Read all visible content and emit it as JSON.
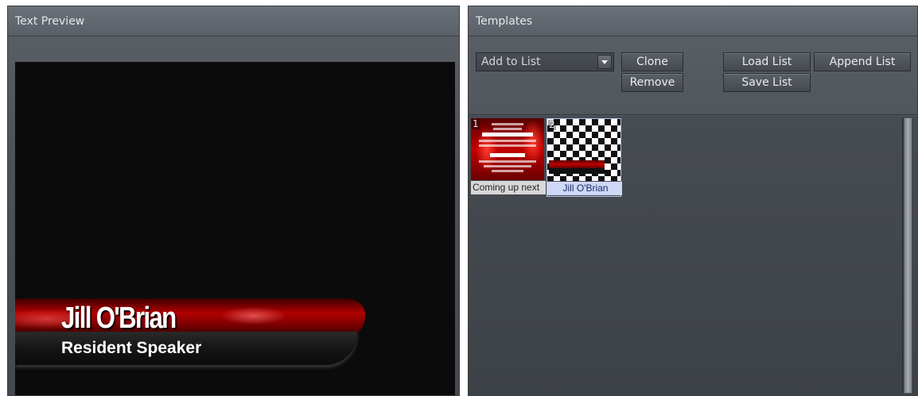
{
  "preview_panel": {
    "title": "Text Preview",
    "lower_third": {
      "name": "Jill O'Brian",
      "title": "Resident Speaker"
    }
  },
  "templates_panel": {
    "title": "Templates",
    "list_select": {
      "value": "Add to List"
    },
    "buttons": {
      "clone": "Clone",
      "remove": "Remove",
      "load_list": "Load List",
      "save_list": "Save List",
      "append_list": "Append List"
    },
    "items": [
      {
        "index": "1",
        "label": "Coming up next"
      },
      {
        "index": "2",
        "label": "Jill O'Brian"
      }
    ]
  },
  "colors": {
    "panel": "#4d5258",
    "header": "#5f656c",
    "preview_bg": "#0b0b0c",
    "accent_red": "#b10000",
    "selection": "#cfd8f6"
  }
}
